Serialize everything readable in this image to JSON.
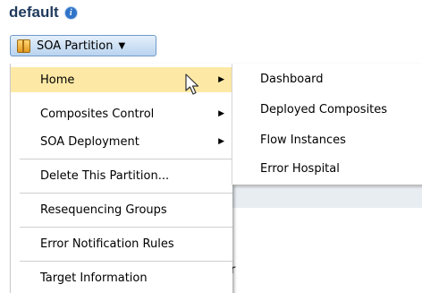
{
  "page_title": "default",
  "partition_button": {
    "label": "SOA Partition"
  },
  "menu": {
    "items": [
      {
        "label": "Home"
      },
      {
        "label": "Composites Control"
      },
      {
        "label": "SOA Deployment"
      },
      {
        "label": "Delete This Partition..."
      },
      {
        "label": "Resequencing Groups"
      },
      {
        "label": "Error Notification Rules"
      },
      {
        "label": "Target Information"
      }
    ]
  },
  "submenu": {
    "items": [
      {
        "label": "Dashboard"
      },
      {
        "label": "Deployed Composites"
      },
      {
        "label": "Flow Instances"
      },
      {
        "label": "Error Hospital"
      }
    ]
  },
  "colors": {
    "title": "#1f3a5c",
    "highlight": "#fde9a5",
    "button_border": "#6f9ac9"
  },
  "icons": [
    "info-icon",
    "package-icon",
    "caret-down-icon",
    "submenu-arrow-icon",
    "mouse-cursor-icon"
  ]
}
